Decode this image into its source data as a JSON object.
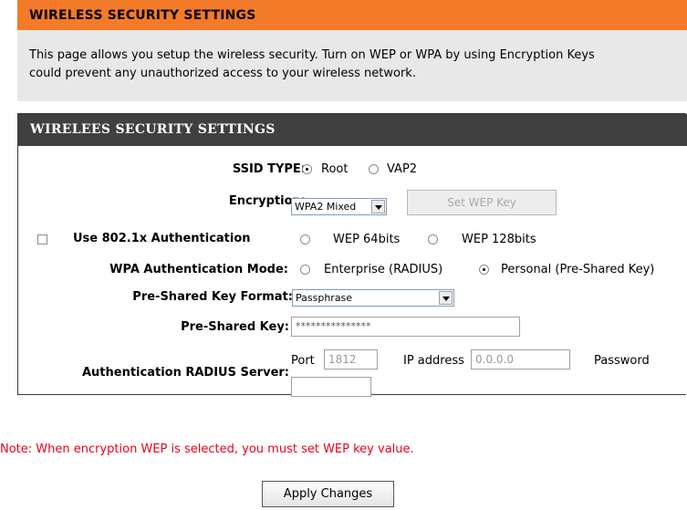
{
  "intro": {
    "title": "WIRELESS SECURITY SETTINGS",
    "line1": "This page allows you setup the wireless security. Turn on WEP or WPA by using Encryption Keys",
    "line2": "could prevent any unauthorized access to your wireless network."
  },
  "panel": {
    "title": "WIRELEES SECURITY SETTINGS",
    "ssid_type": {
      "label": "SSID TYPE:",
      "options": [
        "Root",
        "VAP2"
      ],
      "selected": "Root"
    },
    "encryption": {
      "label": "Encryption:",
      "value": "WPA2 Mixed",
      "set_wep_button": "Set WEP Key"
    },
    "auth_8021x": {
      "label": "Use 802.1x Authentication",
      "checked": false,
      "options": [
        "WEP 64bits",
        "WEP 128bits"
      ]
    },
    "wpa_mode": {
      "label": "WPA Authentication Mode:",
      "options": [
        "Enterprise (RADIUS)",
        "Personal (Pre-Shared Key)"
      ],
      "selected": "Personal (Pre-Shared Key)"
    },
    "psk_format": {
      "label": "Pre-Shared Key Format:",
      "value": "Passphrase"
    },
    "psk": {
      "label": "Pre-Shared Key:",
      "value": "***************"
    },
    "radius": {
      "label": "Authentication RADIUS Server:",
      "port_label": "Port",
      "port_value": "1812",
      "ip_label": "IP address",
      "ip_value": "0.0.0.0",
      "password_label": "Password",
      "password_value": ""
    }
  },
  "note": "Note: When encryption WEP is selected, you must set WEP key value.",
  "apply_button": "Apply Changes",
  "colors": {
    "intro_header": "#f37a28",
    "panel_header": "#404040",
    "note_text": "#e8001c"
  }
}
